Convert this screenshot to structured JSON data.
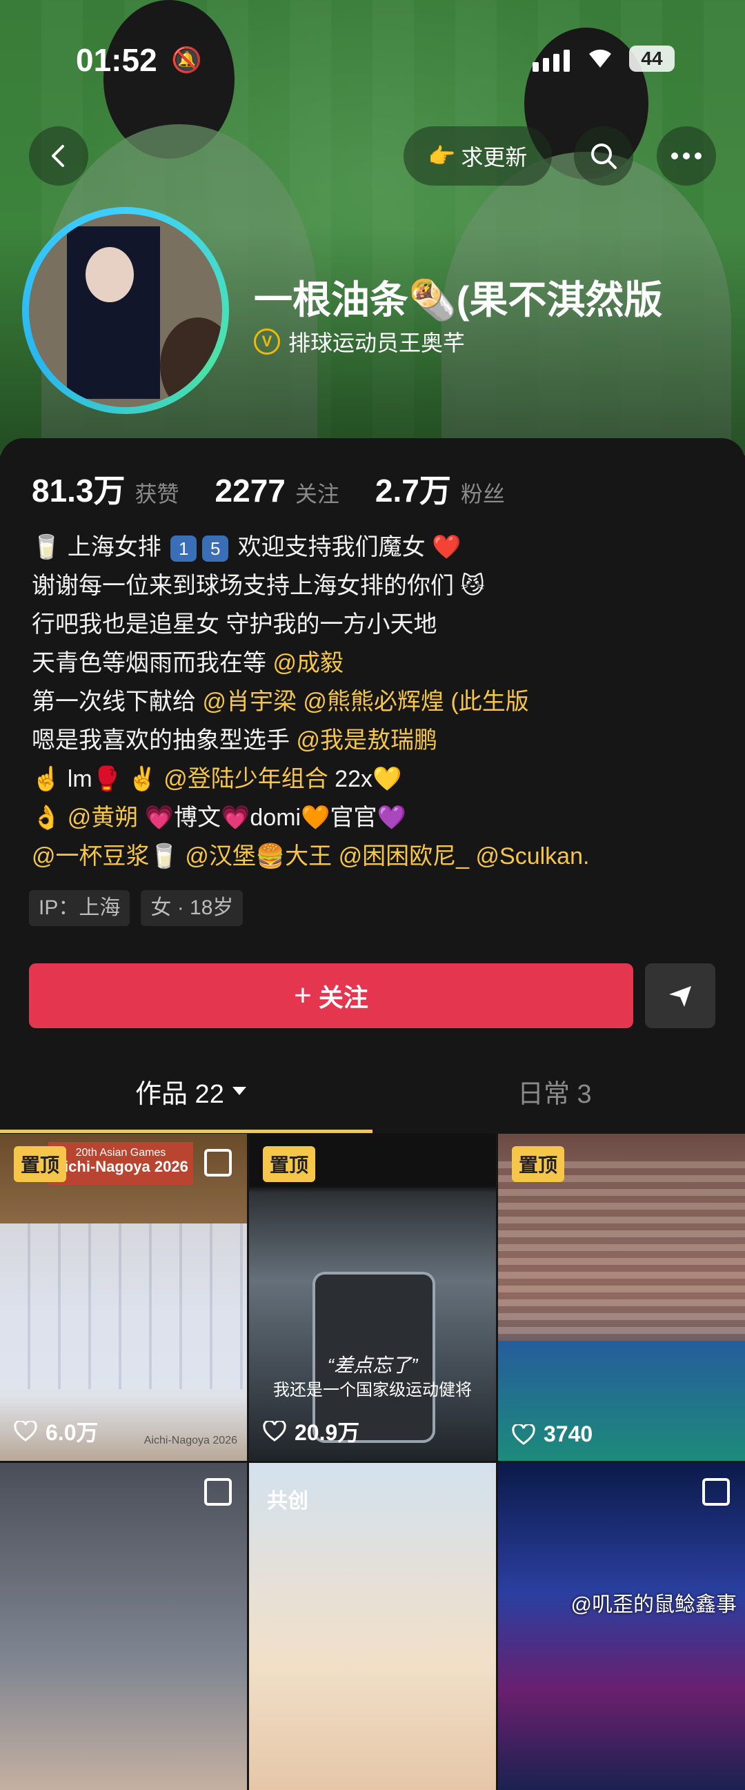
{
  "status_bar": {
    "time": "01:52",
    "battery": "44"
  },
  "header": {
    "update_label": "求更新"
  },
  "profile": {
    "nickname": "一根油条🌯(果不淇然版",
    "verify_label": "排球运动员王奥芊"
  },
  "stats": [
    {
      "value": "81.3万",
      "label": "获赞"
    },
    {
      "value": "2277",
      "label": "关注"
    },
    {
      "value": "2.7万",
      "label": "粉丝"
    }
  ],
  "bio": {
    "l1_pre": "🥛 上海女排",
    "l1_box1": "1",
    "l1_box2": "5",
    "l1_post": "欢迎支持我们魔女 ❤️",
    "l2": "谢谢每一位来到球场支持上海女排的你们 😼",
    "l3": "行吧我也是追星女 守护我的一方小天地",
    "l4_pre": "天青色等烟雨而我在等 ",
    "l4_m1": "@成毅",
    "l5_pre": "第一次线下献给 ",
    "l5_m1": "@肖宇梁",
    "l5_m2": "@熊熊必辉煌 (此生版",
    "l6_pre": "嗯是我喜欢的抽象型选手 ",
    "l6_m1": "@我是敖瑞鹏",
    "l7_pre": "☝️ lm🥊  ✌️ ",
    "l7_m1": "@登陆少年组合",
    "l7_post": " 22x💛",
    "l8_pre": "👌 ",
    "l8_m1": "@黄朔",
    "l8_post": " 💗博文💗domi🧡官官💜",
    "l9_m1": "@一杯豆浆🥛",
    "l9_m2": "@汉堡🍔大王",
    "l9_m3": "@困困欧尼_",
    "l9_m4": "@Sculkan."
  },
  "tags": [
    "IP：上海",
    "女 · 18岁"
  ],
  "actions": {
    "follow_label": "关注",
    "follow_plus": "+"
  },
  "tabs": {
    "works_label": "作品 22",
    "daily_label": "日常 3"
  },
  "grid": {
    "pin_label": "置顶",
    "copub_label": "共创",
    "items": [
      {
        "likes": "6.0万",
        "banner_line1": "20th Asian Games",
        "banner_line2": "Aichi-Nagoya 2026",
        "footer": "Aichi-Nagoya 2026"
      },
      {
        "likes": "20.9万",
        "caption_quote": "“差点忘了”",
        "caption": "我还是一个国家级运动健将"
      },
      {
        "likes": "3740"
      },
      {},
      {},
      {}
    ]
  },
  "watermark": "@叽歪的鼠鲶鑫事"
}
